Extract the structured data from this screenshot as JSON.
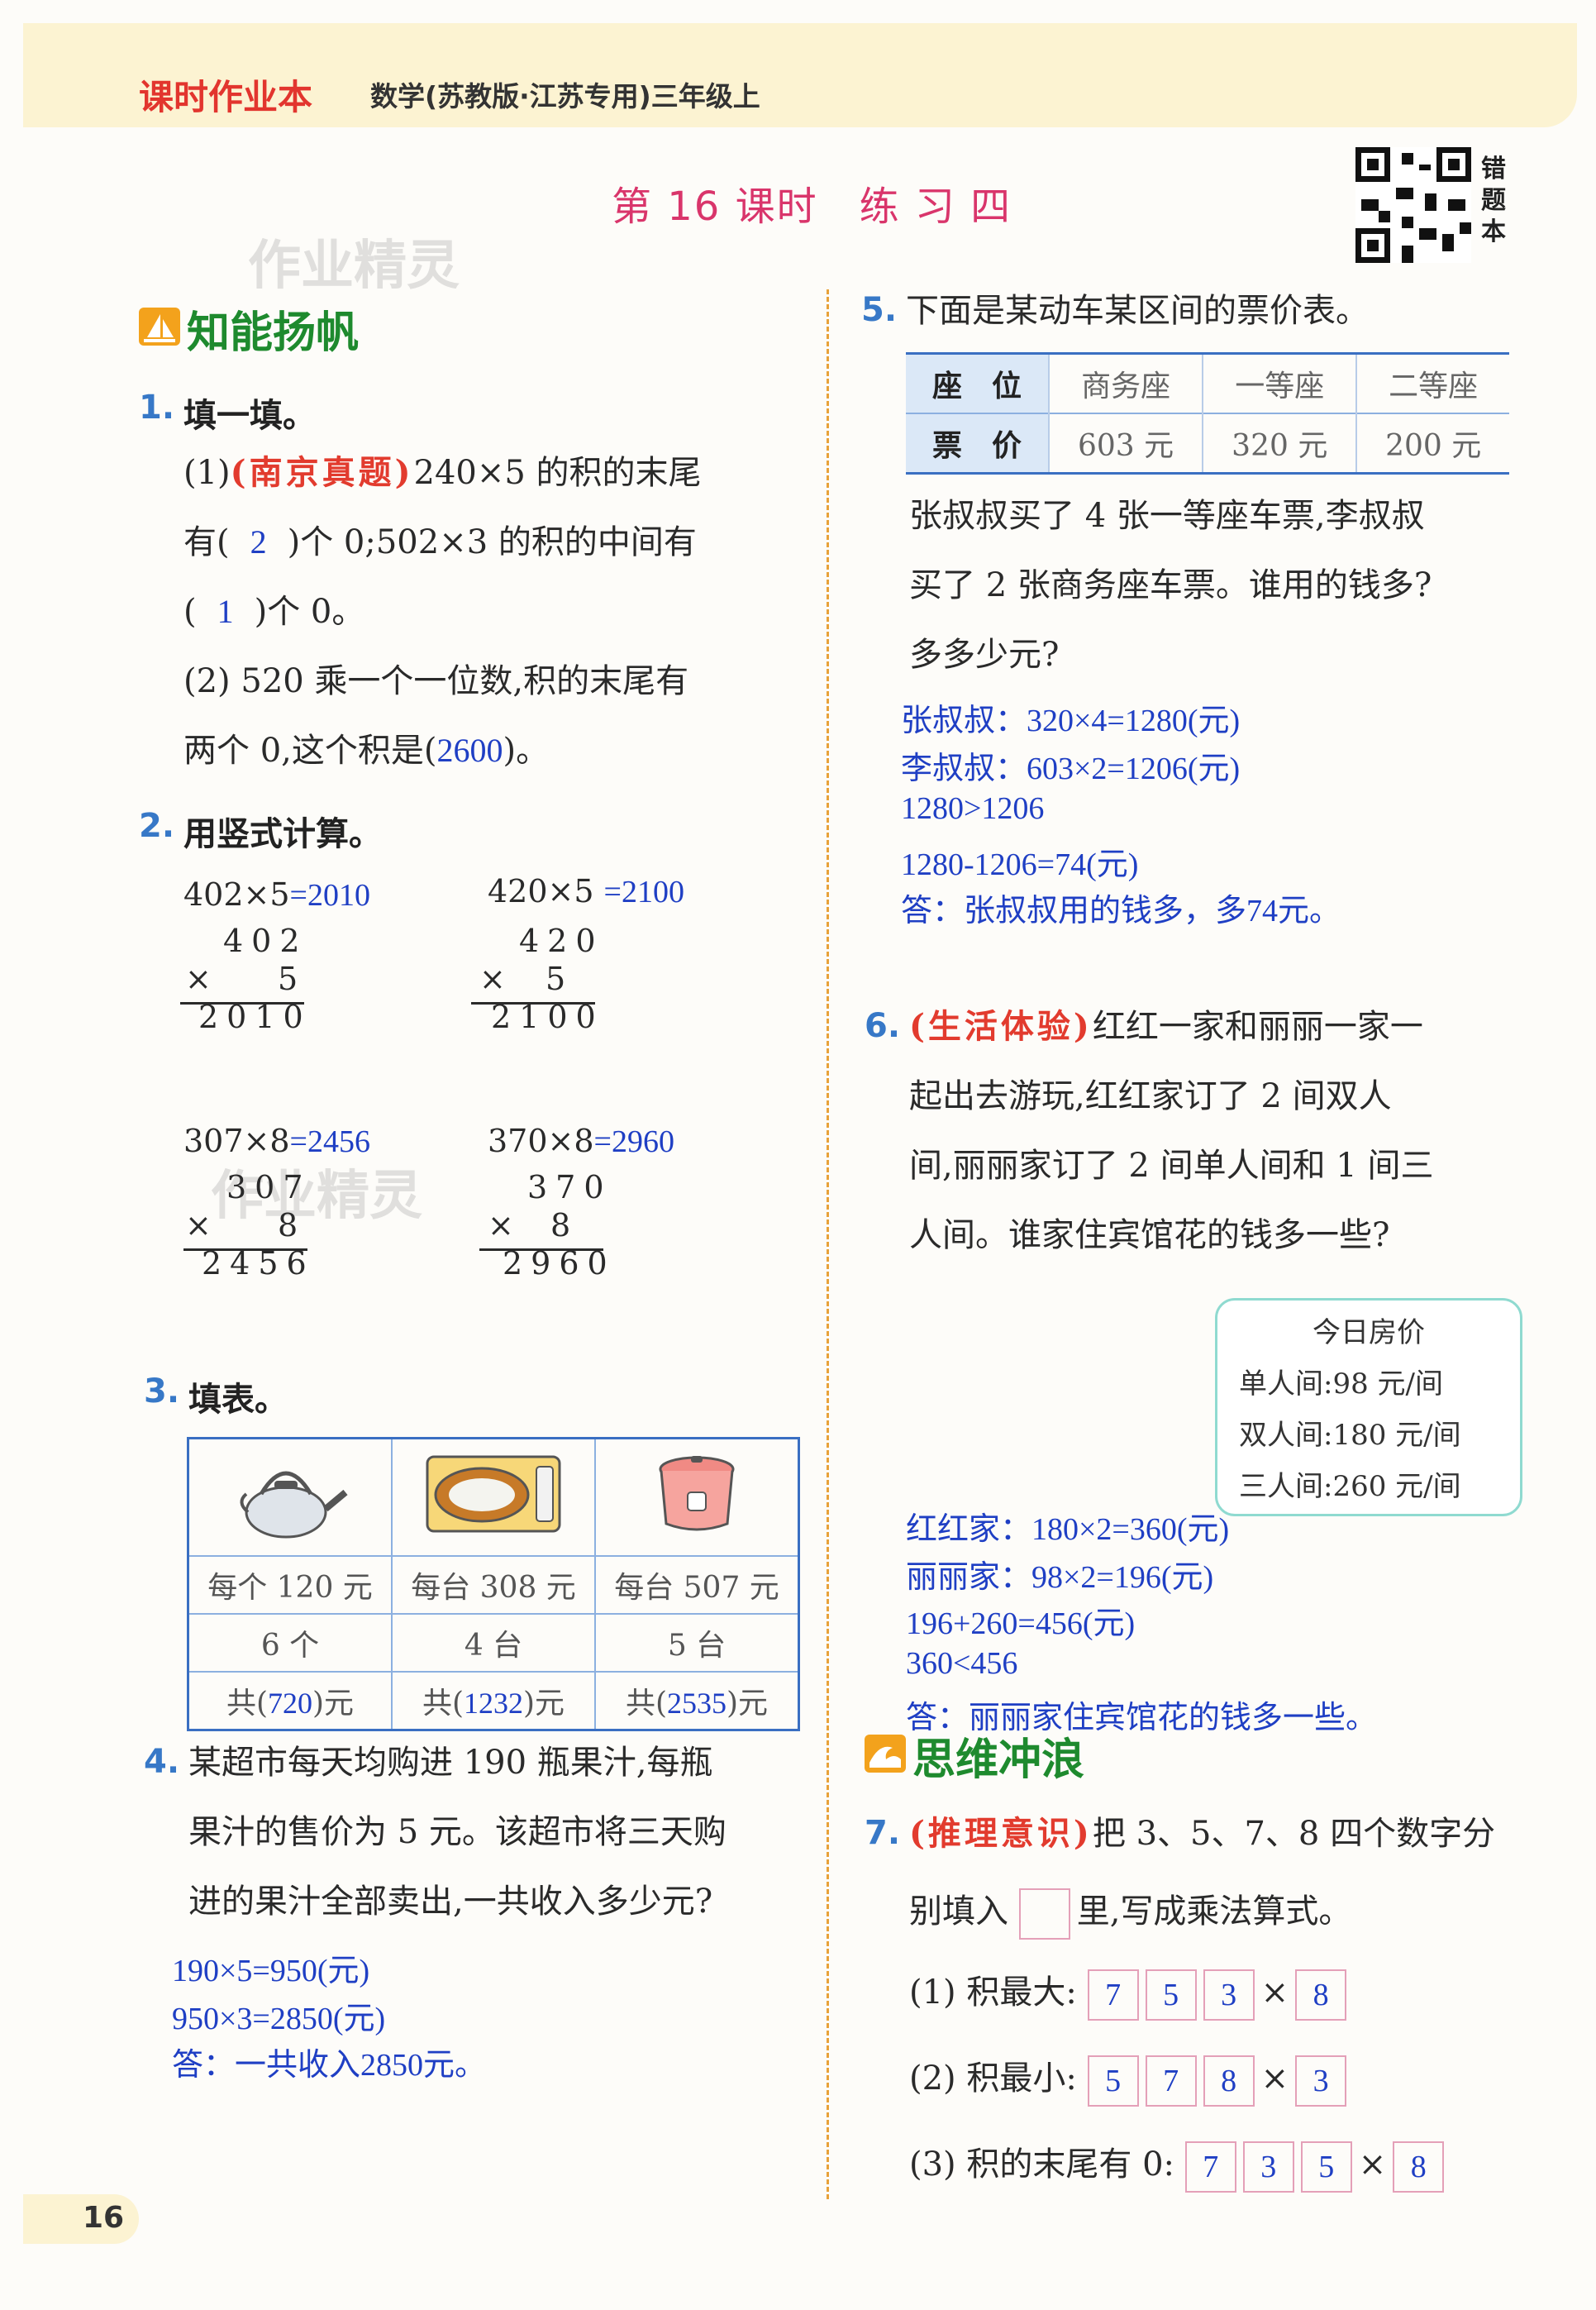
{
  "header": {
    "brand": "课时作业本",
    "subject": "数学(苏教版·江苏专用)三年级上"
  },
  "lesson_title": "第 16 课时　练 习 四",
  "qr_label": "错题本",
  "watermark": "作业精灵",
  "sections": {
    "s1": "知能扬帆",
    "s2": "思维冲浪"
  },
  "q1": {
    "num": "1.",
    "title": "填一填。",
    "p1_prefix": "(1)",
    "p1_tag": "(南京真题)",
    "p1_text_a": "240×5 的积的末尾",
    "p1_text_b1": "有(",
    "p1_ans1": "2",
    "p1_text_b2": ")个 0;502×3 的积的中间有",
    "p1_text_c1": "(",
    "p1_ans2": "1",
    "p1_text_c2": ")个 0。",
    "p2_line1": "(2) 520 乘一个一位数,积的末尾有",
    "p2_text_a": "两个 0,这个积是(",
    "p2_ans": "2600",
    "p2_text_b": ")。"
  },
  "q2": {
    "num": "2.",
    "title": "用竖式计算。",
    "items": [
      {
        "expr": "402×5",
        "ans": "=2010",
        "top": "402",
        "mul": "5",
        "res": "2010"
      },
      {
        "expr": "420×5",
        "ans": "=2100",
        "top": "420",
        "mul": "5",
        "res": "2100"
      },
      {
        "expr": "307×8",
        "ans": "=2456",
        "top": "307",
        "mul": "8",
        "res": "2456"
      },
      {
        "expr": "370×8",
        "ans": "=2960",
        "top": "370",
        "mul": "8",
        "res": "2960"
      }
    ],
    "times": "×"
  },
  "q3": {
    "num": "3.",
    "title": "填表。",
    "icons": [
      "kettle-icon",
      "microwave-icon",
      "rice-cooker-icon"
    ],
    "prices": [
      "每个 120 元",
      "每台 308 元",
      "每台 507 元"
    ],
    "counts": [
      "6 个",
      "4 台",
      "5 台"
    ],
    "totals": [
      {
        "pre": "共(",
        "ans": "720",
        "post": ")元"
      },
      {
        "pre": "共(",
        "ans": "1232",
        "post": ")元"
      },
      {
        "pre": "共(",
        "ans": "2535",
        "post": ")元"
      }
    ]
  },
  "q4": {
    "num": "4.",
    "lines": [
      "某超市每天均购进 190 瓶果汁,每瓶",
      "果汁的售价为 5 元。该超市将三天购",
      "进的果汁全部卖出,一共收入多少元?"
    ],
    "answer": [
      "190×5=950(元)",
      "950×3=2850(元)",
      "答：一共收入2850元。"
    ]
  },
  "q5": {
    "num": "5.",
    "title": "下面是某动车某区间的票价表。",
    "table": {
      "h_seat": "座　位",
      "h_price": "票　价",
      "seats": [
        "商务座",
        "一等座",
        "二等座"
      ],
      "prices": [
        "603 元",
        "320 元",
        "200 元"
      ]
    },
    "lines": [
      "张叔叔买了 4 张一等座车票,李叔叔",
      "买了 2 张商务座车票。谁用的钱多?",
      "多多少元?"
    ],
    "answer": [
      "张叔叔：320×4=1280(元)",
      "李叔叔：603×2=1206(元)",
      "1280>1206",
      "1280-1206=74(元)",
      "答：张叔叔用的钱多，多74元。"
    ]
  },
  "q6": {
    "num": "6.",
    "tag": "(生活体验)",
    "line1": "红红一家和丽丽一家一",
    "lines": [
      "起出去游玩,红红家订了 2 间双人",
      "间,丽丽家订了 2 间单人间和 1 间三",
      "人间。谁家住宾馆花的钱多一些?"
    ],
    "pricebox": {
      "title": "今日房价",
      "items": [
        "单人间:98 元/间",
        "双人间:180 元/间",
        "三人间:260 元/间"
      ]
    },
    "answer": [
      "红红家：180×2=360(元)",
      "丽丽家：98×2=196(元)",
      "196+260=456(元)",
      "360<456",
      "答：丽丽家住宾馆花的钱多一些。"
    ]
  },
  "q7": {
    "num": "7.",
    "tag": "(推理意识)",
    "line1": "把 3、5、7、8 四个数字分",
    "line2a": "别填入",
    "line2b": "里,写成乘法算式。",
    "rows": [
      {
        "label": "(1) 积最大:",
        "digits": [
          "7",
          "5",
          "3"
        ],
        "mul": "8"
      },
      {
        "label": "(2) 积最小:",
        "digits": [
          "5",
          "7",
          "8"
        ],
        "mul": "3"
      },
      {
        "label": "(3) 积的末尾有 0:",
        "digits": [
          "7",
          "3",
          "5"
        ],
        "mul": "8"
      }
    ],
    "times": "×"
  },
  "page_number": "16"
}
